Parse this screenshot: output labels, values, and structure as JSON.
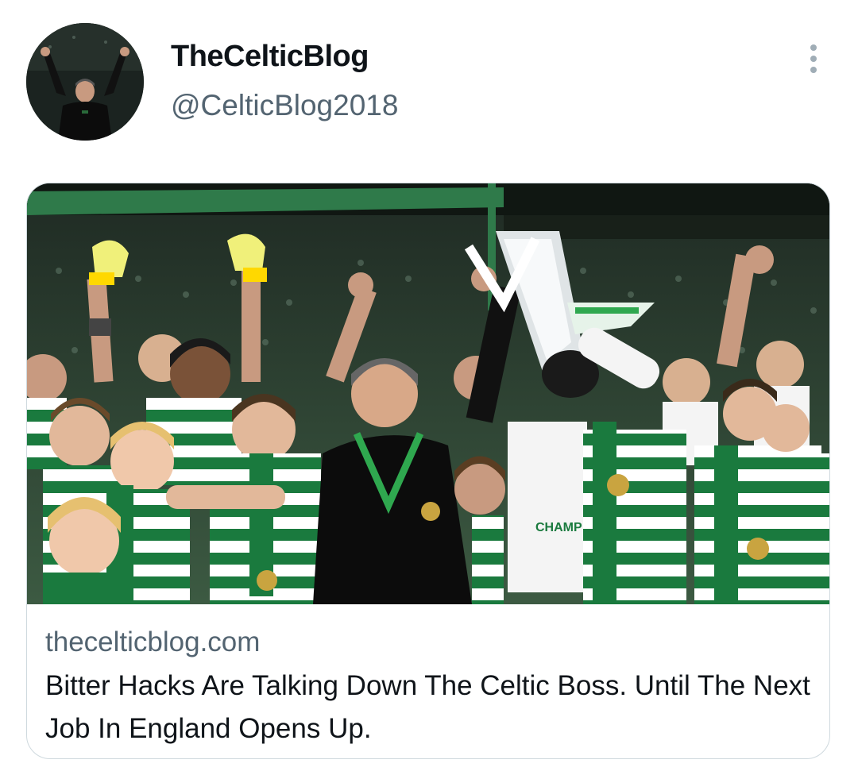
{
  "user": {
    "display_name": "TheCelticBlog",
    "handle": "@CelticBlog2018",
    "avatar_icon": "profile-photo-manager-fists-raised"
  },
  "more_icon": "more-vertical-dots-icon",
  "card": {
    "domain": "thecelticblog.com",
    "title": "Bitter Hacks Are Talking Down The Celtic Boss. Until The Next Job In England Opens Up.",
    "image_description_icon": "celtic-team-celebrating-with-trophy-photo",
    "shirt_text": "CHAMP"
  },
  "colors": {
    "text_primary": "#0f1419",
    "text_secondary": "#536471",
    "border": "#cfd9de",
    "celtic_green": "#1a7a3e"
  }
}
